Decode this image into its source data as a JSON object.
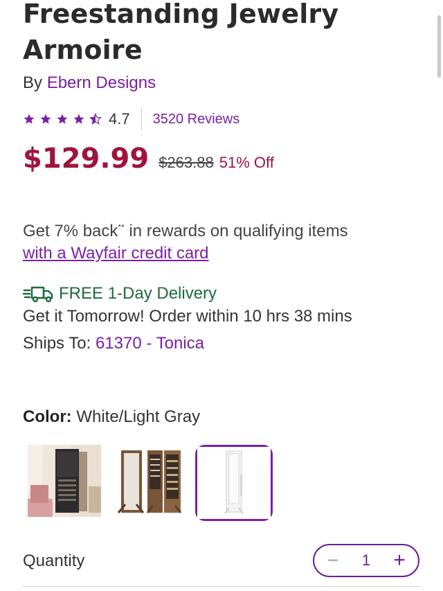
{
  "product": {
    "title": "Freestanding Jewelry Armoire",
    "by_prefix": "By",
    "brand": "Ebern Designs"
  },
  "rating": {
    "value": "4.7",
    "stars": 4.7,
    "reviews": "3520 Reviews",
    "star_color": "#7b1fa2"
  },
  "pricing": {
    "price": "$129.99",
    "was_price": "$263.88",
    "discount": "51% Off",
    "price_color": "#a0133d"
  },
  "rewards": {
    "text": "Get 7% back",
    "sup": "**",
    "text2": " in rewards on qualifying items",
    "link": "with a Wayfair credit card"
  },
  "delivery": {
    "icon": "truck-icon",
    "free": "FREE 1-Day Delivery",
    "eta": "Get it Tomorrow! Order within 10 hrs 38 mins",
    "ships_label": "Ships To:",
    "zip": "61370 - Tonica"
  },
  "color": {
    "label": "Color:",
    "value": "White/Light Gray",
    "swatches": [
      "Black in bedroom",
      "Rustic brown",
      "White/Light Gray"
    ],
    "selected_index": 2
  },
  "quantity": {
    "label": "Quantity",
    "value": "1",
    "minus": "−",
    "plus": "+"
  },
  "theme": {
    "accent": "#7b1fa2",
    "delivery_green": "#1c6b3b"
  }
}
